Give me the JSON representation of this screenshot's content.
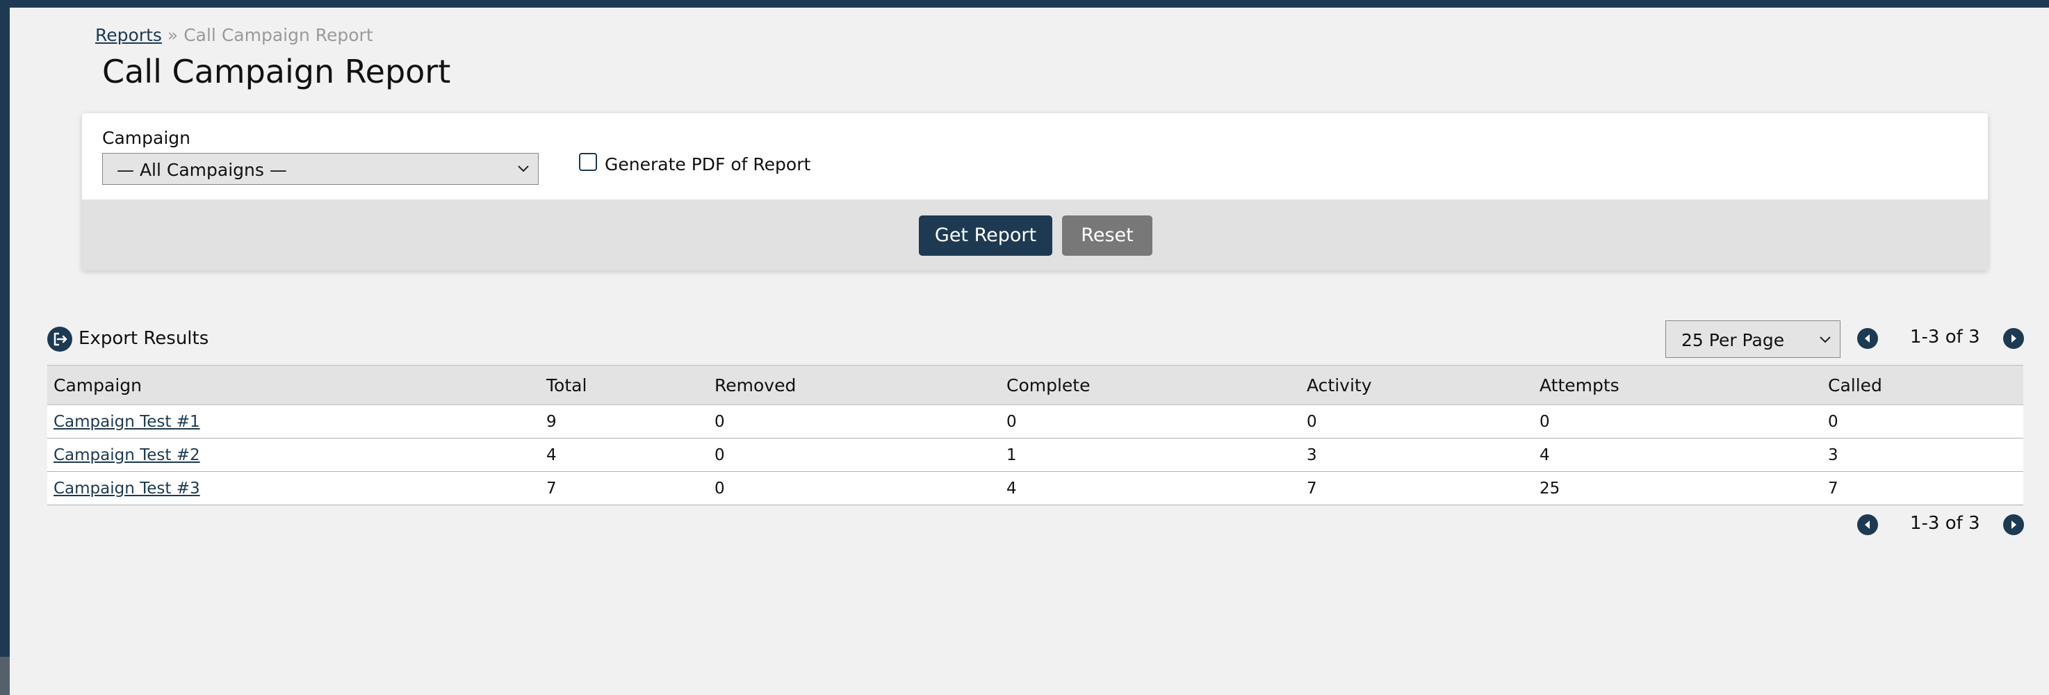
{
  "breadcrumb": {
    "parent": "Reports",
    "separator": "»",
    "current": "Call Campaign Report"
  },
  "page_title": "Call Campaign Report",
  "filters": {
    "campaign_label": "Campaign",
    "campaign_selected": "— All Campaigns —",
    "pdf_label": "Generate PDF of Report",
    "pdf_checked": false,
    "get_report_label": "Get Report",
    "reset_label": "Reset"
  },
  "results": {
    "export_label": "Export Results",
    "per_page": "25 Per Page",
    "count_text": "1-3 of 3",
    "columns": [
      "Campaign",
      "Total",
      "Removed",
      "Complete",
      "Activity",
      "Attempts",
      "Called"
    ],
    "rows": [
      [
        "Campaign Test #1",
        "9",
        "0",
        "0",
        "0",
        "0",
        "0"
      ],
      [
        "Campaign Test #2",
        "4",
        "0",
        "1",
        "3",
        "4",
        "3"
      ],
      [
        "Campaign Test #3",
        "7",
        "0",
        "4",
        "7",
        "25",
        "7"
      ]
    ]
  },
  "colors": {
    "primary": "#1d3a52",
    "secondary": "#787878",
    "background": "#f1f1f1"
  },
  "icons": [
    "export-icon",
    "chevron-down-icon",
    "previous-page-icon",
    "next-page-icon"
  ]
}
